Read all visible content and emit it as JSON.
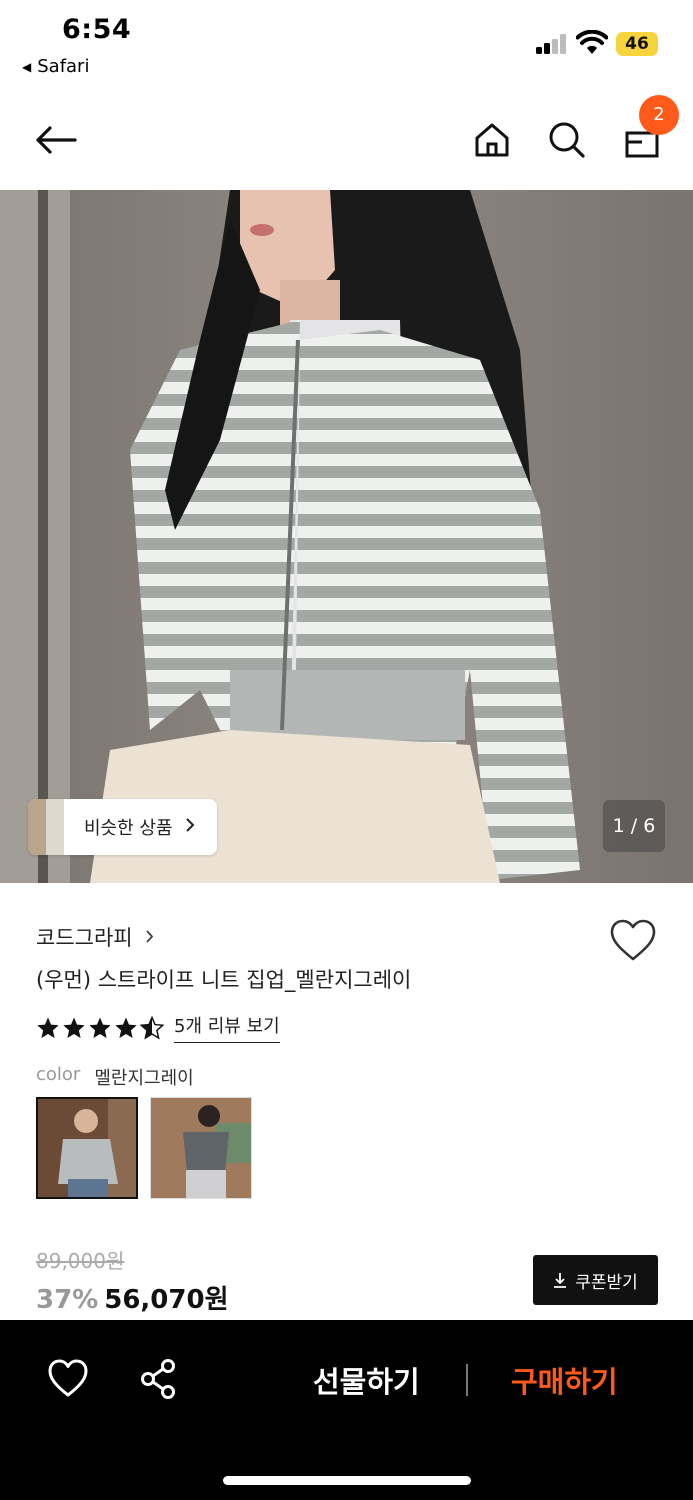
{
  "status": {
    "time": "6:54",
    "back_app": "Safari",
    "battery": "46"
  },
  "nav": {
    "cart_count": "2",
    "icons": [
      "back-arrow-icon",
      "home-icon",
      "search-icon",
      "cart-bag-icon"
    ]
  },
  "gallery": {
    "similar_label": "비슷한 상품",
    "counter": "1 / 6"
  },
  "product": {
    "brand": "코드그라피",
    "title": "(우먼) 스트라이프 니트 집업_멜란지그레이",
    "rating": 4.5,
    "review_link": "5개 리뷰 보기",
    "color_key": "color",
    "color_value": "멜란지그레이"
  },
  "price": {
    "original": "89,000원",
    "discount": "37%",
    "sale": "56,070원",
    "coupon_label": "쿠폰받기"
  },
  "bottom": {
    "gift_label": "선물하기",
    "buy_label": "구매하기"
  },
  "colors": {
    "accent": "#ff5a1a",
    "badge_bg": "#ff5a1a",
    "bottom_bar": "#000000",
    "battery": "#f7d43c"
  }
}
